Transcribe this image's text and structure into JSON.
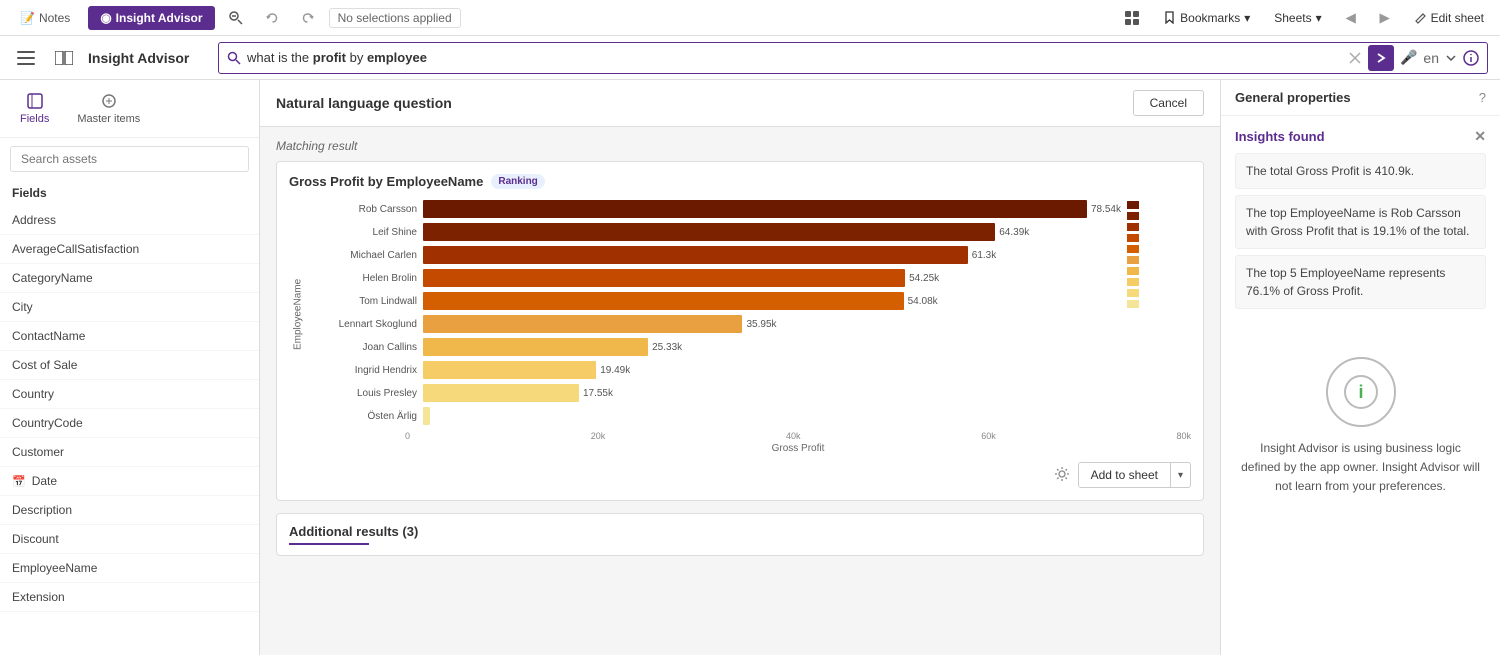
{
  "topBar": {
    "notes_label": "Notes",
    "insight_label": "Insight Advisor",
    "no_selections": "No selections applied",
    "bookmarks_label": "Bookmarks",
    "sheets_label": "Sheets",
    "edit_sheet_label": "Edit sheet"
  },
  "secondBar": {
    "title": "Insight Advisor",
    "search_query_prefix": "what is the ",
    "search_query_highlight1": "profit",
    "search_query_mid": " by ",
    "search_query_highlight2": "employee",
    "lang": "en"
  },
  "leftPanel": {
    "search_placeholder": "Search assets",
    "fields_label": "Fields",
    "fields_icon_label": "Fields",
    "master_items_label": "Master items",
    "field_items": [
      {
        "name": "Address",
        "has_icon": false
      },
      {
        "name": "AverageCallSatisfaction",
        "has_icon": false
      },
      {
        "name": "CategoryName",
        "has_icon": false
      },
      {
        "name": "City",
        "has_icon": false
      },
      {
        "name": "ContactName",
        "has_icon": false
      },
      {
        "name": "Cost of Sale",
        "has_icon": false
      },
      {
        "name": "Country",
        "has_icon": false
      },
      {
        "name": "CountryCode",
        "has_icon": false
      },
      {
        "name": "Customer",
        "has_icon": false
      },
      {
        "name": "Date",
        "has_icon": true
      },
      {
        "name": "Description",
        "has_icon": false
      },
      {
        "name": "Discount",
        "has_icon": false
      },
      {
        "name": "EmployeeName",
        "has_icon": false
      },
      {
        "name": "Extension",
        "has_icon": false
      }
    ]
  },
  "nlq": {
    "header_title": "Natural language question",
    "cancel_label": "Cancel",
    "matching_result": "Matching result"
  },
  "chart": {
    "title": "Gross Profit by EmployeeName",
    "ranking_badge": "Ranking",
    "y_axis_label": "EmployeeName",
    "x_axis_label": "Gross Profit",
    "x_ticks": [
      "0",
      "20k",
      "40k",
      "60k",
      "80k"
    ],
    "bars": [
      {
        "name": "Rob Carsson",
        "value": 78540,
        "label": "78.54k",
        "pct": 100
      },
      {
        "name": "Leif Shine",
        "value": 64390,
        "label": "64.39k",
        "pct": 82
      },
      {
        "name": "Michael Carlen",
        "value": 61300,
        "label": "61.3k",
        "pct": 78
      },
      {
        "name": "Helen Brolin",
        "value": 54250,
        "label": "54.25k",
        "pct": 69
      },
      {
        "name": "Tom Lindwall",
        "value": 54080,
        "label": "54.08k",
        "pct": 69
      },
      {
        "name": "Lennart Skoglund",
        "value": 35950,
        "label": "35.95k",
        "pct": 46
      },
      {
        "name": "Joan Callins",
        "value": 25330,
        "label": "25.33k",
        "pct": 32
      },
      {
        "name": "Ingrid Hendrix",
        "value": 19490,
        "label": "19.49k",
        "pct": 25
      },
      {
        "name": "Louis Presley",
        "value": 17550,
        "label": "17.55k",
        "pct": 22
      },
      {
        "name": "Östen Ärlig",
        "value": 0,
        "label": "",
        "pct": 1
      }
    ],
    "bar_colors": [
      "#6b1a00",
      "#7d2200",
      "#a03000",
      "#c44a00",
      "#d45f00",
      "#e8a040",
      "#f0b84a",
      "#f5cc66",
      "#f5d97a",
      "#f5e599"
    ],
    "add_sheet_label": "Add to sheet",
    "settings_icon": "⚙"
  },
  "additional": {
    "title": "Additional results (3)"
  },
  "rightPanel": {
    "general_properties": "General properties",
    "insights_found_title": "Insights found",
    "insights": [
      "The total Gross Profit is 410.9k.",
      "The top EmployeeName is Rob Carsson with Gross Profit that is 19.1% of the total.",
      "The top 5 EmployeeName represents 76.1% of Gross Profit."
    ],
    "advisor_text": "Insight Advisor is using business logic defined by the app owner. Insight Advisor will not learn from your preferences."
  }
}
